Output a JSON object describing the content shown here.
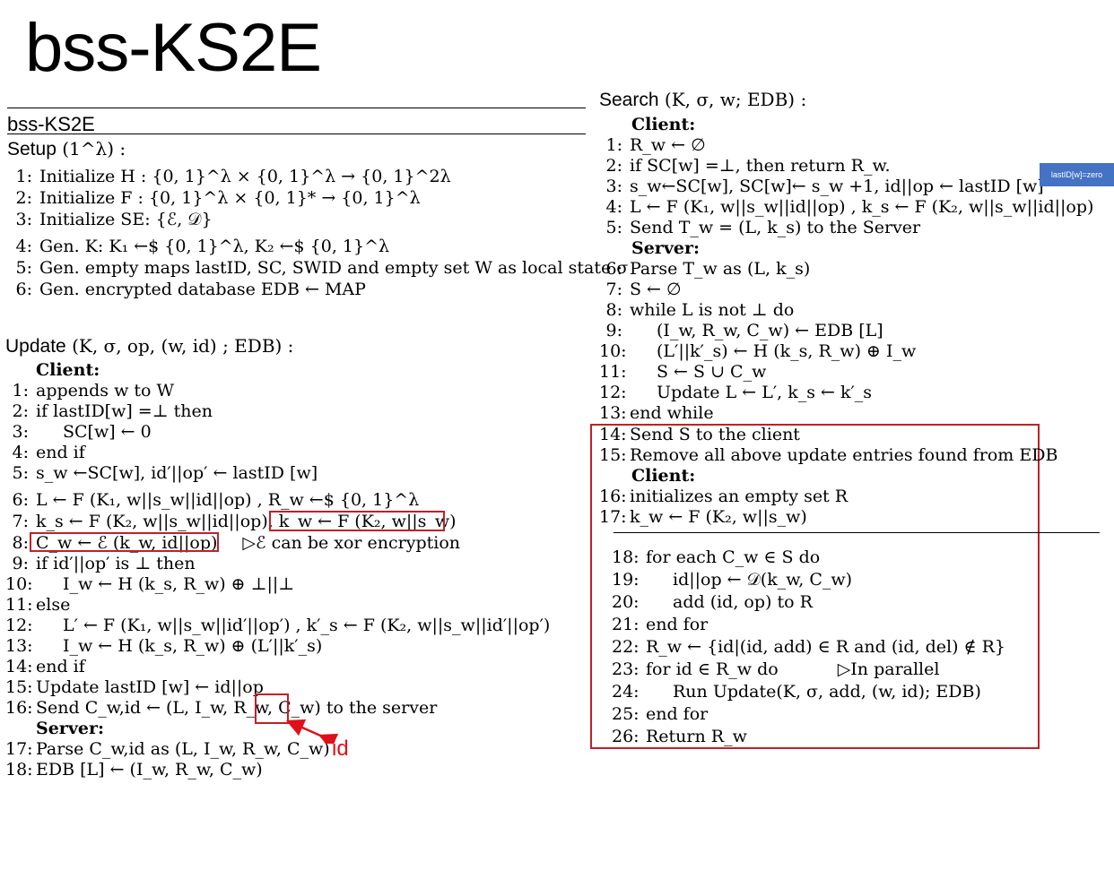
{
  "slide": {
    "title": "bss-KS2E"
  },
  "algorithm": {
    "header": "bss-KS2E"
  },
  "setup": {
    "heading": "Setup",
    "params": "(1^λ) :",
    "lines": [
      {
        "n": "1:",
        "t": "Initialize H : {0, 1}^λ × {0, 1}^λ → {0, 1}^2λ"
      },
      {
        "n": "2:",
        "t": "Initialize F : {0, 1}^λ × {0, 1}* → {0, 1}^λ"
      },
      {
        "n": "3:",
        "t": "Initialize SE: {ℰ, 𝒟}"
      },
      {
        "n": "4:",
        "t": "Gen. K: K₁ ←$ {0, 1}^λ, K₂ ←$ {0, 1}^λ"
      },
      {
        "n": "5:",
        "t": "Gen. empty maps lastID, SC, SWID and empty set W as local state σ"
      },
      {
        "n": "6:",
        "t": "Gen. encrypted database EDB ← MAP"
      }
    ]
  },
  "update": {
    "heading": "Update",
    "params": "(K, σ, op, (w, id) ; EDB) :",
    "client_label": "Client:",
    "server_label": "Server:",
    "lines": [
      {
        "n": "1:",
        "t": "appends w to W"
      },
      {
        "n": "2:",
        "t": "if lastID[w] =⊥ then"
      },
      {
        "n": "3:",
        "t": "SC[w] ← 0"
      },
      {
        "n": "4:",
        "t": "end if"
      },
      {
        "n": "5:",
        "t": "s_w ←SC[w], id′||op′ ← lastID [w]"
      },
      {
        "n": "6:",
        "t": "L ← F (K₁, w||s_w||id||op) , R_w ←$ {0, 1}^λ"
      },
      {
        "n": "7:",
        "t": "k_s ← F (K₂, w||s_w||id||op), k_w ← F (K₂, w||s_w)"
      },
      {
        "n": "8:",
        "t": "C_w ← ℰ (k_w, id||op)",
        "comment": "▷ℰ can be xor encryption"
      },
      {
        "n": "9:",
        "t": "if id′||op′ is ⊥ then"
      },
      {
        "n": "10:",
        "t": "I_w ← H (k_s, R_w) ⊕ ⊥||⊥"
      },
      {
        "n": "11:",
        "t": "else"
      },
      {
        "n": "12:",
        "t": "L′ ← F (K₁, w||s_w||id′||op′) , k′_s ← F (K₂, w||s_w||id′||op′)"
      },
      {
        "n": "13:",
        "t": "I_w ← H (k_s, R_w) ⊕ (L′||k′_s)"
      },
      {
        "n": "14:",
        "t": "end if"
      },
      {
        "n": "15:",
        "t": "Update lastID [w] ← id||op"
      },
      {
        "n": "16:",
        "t": "Send C_w,id ← (L, I_w, R_w, C_w) to the server"
      },
      {
        "n": "17:",
        "t": "Parse C_w,id as (L, I_w, R_w, C_w)"
      },
      {
        "n": "18:",
        "t": "EDB [L] ← (I_w, R_w, C_w)"
      }
    ]
  },
  "search": {
    "heading": "Search",
    "params": "(K, σ, w; EDB) :",
    "client_label": "Client:",
    "server_label": "Server:",
    "client2_label": "Client:",
    "lines": [
      {
        "n": "1:",
        "t": "R_w ← ∅"
      },
      {
        "n": "2:",
        "t": "if SC[w] =⊥, then return R_w."
      },
      {
        "n": "3:",
        "t": "s_w←SC[w], SC[w]← s_w +1, id||op ← lastID [w]"
      },
      {
        "n": "4:",
        "t": "L ← F (K₁, w||s_w||id||op) , k_s ← F (K₂, w||s_w||id||op)"
      },
      {
        "n": "5:",
        "t": "Send T_w = (L, k_s) to the Server"
      },
      {
        "n": "6:",
        "t": "Parse T_w as (L, k_s)"
      },
      {
        "n": "7:",
        "t": "S ← ∅"
      },
      {
        "n": "8:",
        "t": "while L is not ⊥ do"
      },
      {
        "n": "9:",
        "t": "(I_w, R_w, C_w) ← EDB [L]"
      },
      {
        "n": "10:",
        "t": "(L′||k′_s) ← H (k_s, R_w) ⊕ I_w"
      },
      {
        "n": "11:",
        "t": "S ← S ∪ C_w"
      },
      {
        "n": "12:",
        "t": "Update L ← L′, k_s ← k′_s"
      },
      {
        "n": "13:",
        "t": "end while"
      },
      {
        "n": "14:",
        "t": "Send S to the client"
      },
      {
        "n": "15:",
        "t": "Remove all above update entries found from EDB"
      },
      {
        "n": "16:",
        "t": "initializes an empty set R"
      },
      {
        "n": "17:",
        "t": "k_w ← F (K₂, w||s_w)"
      },
      {
        "n": "18:",
        "t": "for each C_w ∈ S do"
      },
      {
        "n": "19:",
        "t": "id||op ← 𝒟(k_w, C_w)"
      },
      {
        "n": "20:",
        "t": "add (id, op) to R"
      },
      {
        "n": "21:",
        "t": "end for"
      },
      {
        "n": "22:",
        "t": "R_w ← {id|(id, add) ∈ R and (id, del) ∉ R}"
      },
      {
        "n": "23:",
        "t": "for id ∈ R_w do",
        "comment": "▷In parallel"
      },
      {
        "n": "24:",
        "t": "Run Update(K, σ, add, (w, id); EDB)"
      },
      {
        "n": "25:",
        "t": "end for"
      },
      {
        "n": "26:",
        "t": "Return R_w"
      }
    ]
  },
  "annotations": {
    "sticky_note": "lastID[w]=zero",
    "id_label": "id",
    "accent_color": "#c0202a",
    "sticky_color": "#4472c4"
  }
}
